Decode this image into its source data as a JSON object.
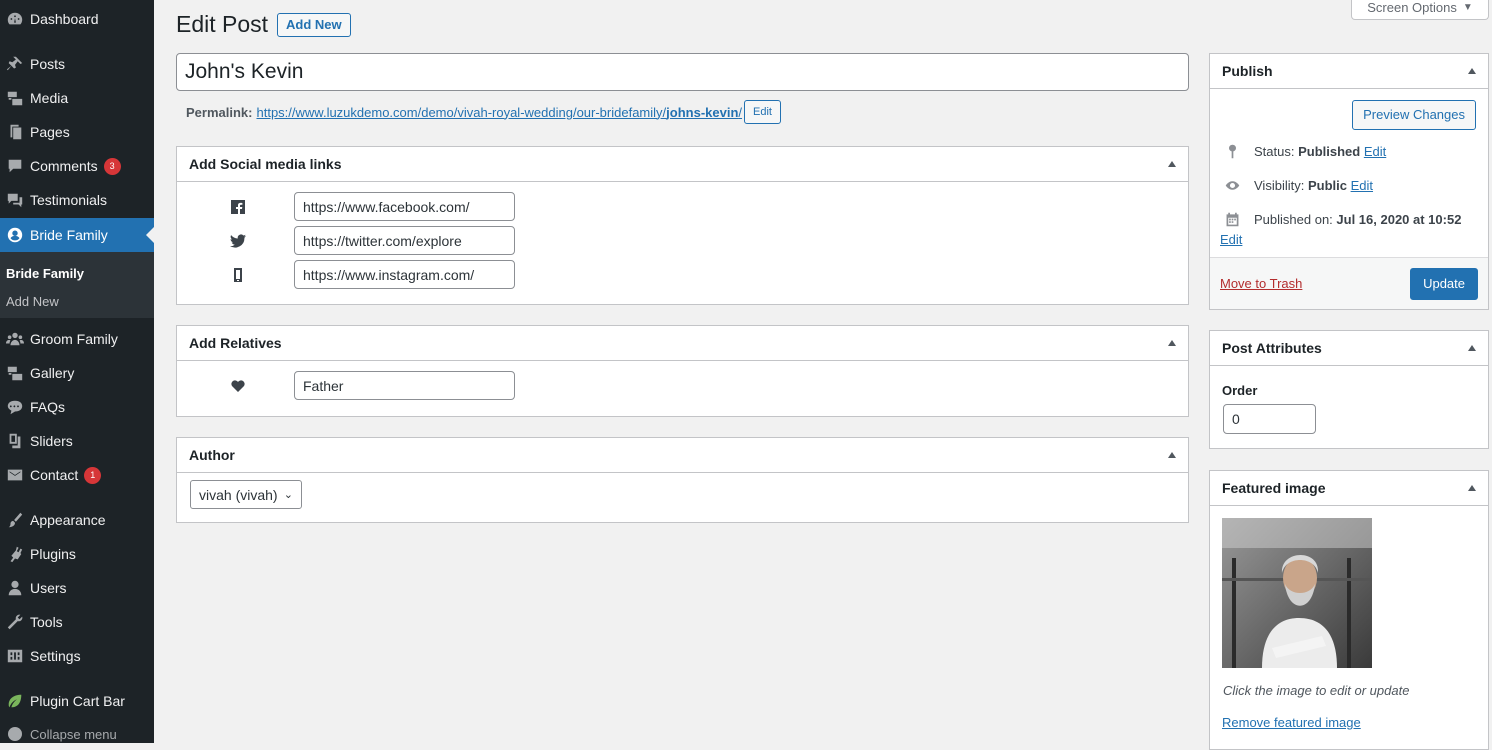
{
  "sidebar": {
    "items": [
      {
        "label": "Dashboard",
        "icon": "dashboard-icon"
      },
      {
        "label": "Posts",
        "icon": "pin-icon"
      },
      {
        "label": "Media",
        "icon": "media-icon"
      },
      {
        "label": "Pages",
        "icon": "pages-icon"
      },
      {
        "label": "Comments",
        "icon": "comment-icon",
        "badge": "3"
      },
      {
        "label": "Testimonials",
        "icon": "testimonial-icon"
      },
      {
        "label": "Bride Family",
        "icon": "bride-icon",
        "active": true
      },
      {
        "label": "Groom Family",
        "icon": "groups-icon"
      },
      {
        "label": "Gallery",
        "icon": "gallery-icon"
      },
      {
        "label": "FAQs",
        "icon": "faq-icon"
      },
      {
        "label": "Sliders",
        "icon": "slides-icon"
      },
      {
        "label": "Contact",
        "icon": "email-icon",
        "badge": "1"
      },
      {
        "label": "Appearance",
        "icon": "brush-icon"
      },
      {
        "label": "Plugins",
        "icon": "plugin-icon"
      },
      {
        "label": "Users",
        "icon": "users-icon"
      },
      {
        "label": "Tools",
        "icon": "wrench-icon"
      },
      {
        "label": "Settings",
        "icon": "settings-icon"
      },
      {
        "label": "Plugin Cart Bar",
        "icon": "leaf-icon"
      }
    ],
    "submenu": [
      "Bride Family",
      "Add New"
    ],
    "collapse_label": "Collapse menu"
  },
  "header": {
    "title": "Edit Post",
    "add_new_label": "Add New",
    "screen_options_label": "Screen Options"
  },
  "post": {
    "title": "John's Kevin",
    "permalink_label": "Permalink:",
    "permalink_base": "https://www.luzukdemo.com/demo/vivah-royal-wedding/our-bridefamily/",
    "permalink_slug": "johns-kevin",
    "permalink_trailing": "/",
    "permalink_edit_label": "Edit"
  },
  "social_box": {
    "title": "Add Social media links",
    "fields": [
      {
        "icon": "facebook-icon",
        "value": "https://www.facebook.com/"
      },
      {
        "icon": "twitter-icon",
        "value": "https://twitter.com/explore"
      },
      {
        "icon": "mobile-icon",
        "value": "https://www.instagram.com/"
      }
    ]
  },
  "relatives_box": {
    "title": "Add Relatives",
    "field": {
      "icon": "heart-icon",
      "value": "Father"
    }
  },
  "author_box": {
    "title": "Author",
    "selected": "vivah (vivah)"
  },
  "publish_box": {
    "title": "Publish",
    "preview_label": "Preview Changes",
    "status_label": "Status:",
    "status_value": "Published",
    "visibility_label": "Visibility:",
    "visibility_value": "Public",
    "published_on_label": "Published on:",
    "published_on_value": "Jul 16, 2020 at 10:52",
    "edit_label": "Edit",
    "trash_label": "Move to Trash",
    "update_label": "Update"
  },
  "attributes_box": {
    "title": "Post Attributes",
    "order_label": "Order",
    "order_value": "0"
  },
  "featured_box": {
    "title": "Featured image",
    "caption": "Click the image to edit or update",
    "remove_label": "Remove featured image"
  },
  "colors": {
    "sidebar_bg": "#1d2327",
    "accent": "#2271b1",
    "badge": "#d63638",
    "trash": "#b32d2e"
  }
}
